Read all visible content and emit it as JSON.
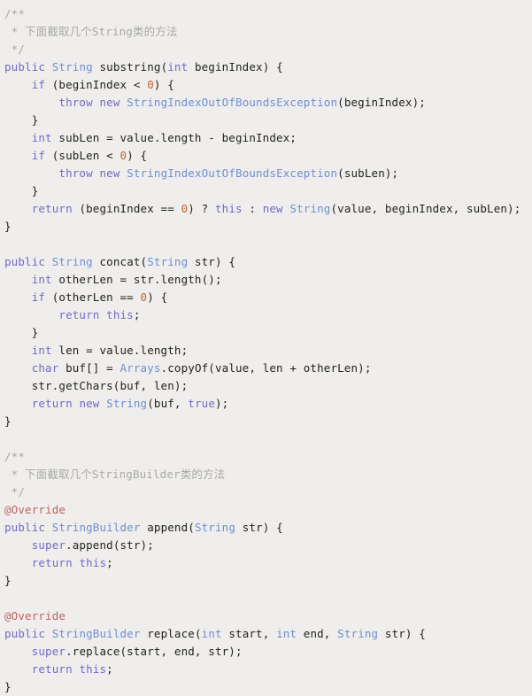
{
  "editor": {
    "language": "java",
    "background_color": "#efeeec",
    "default_text_color": "#22221f",
    "token_colors": {
      "keyword": "#7469c6",
      "type": "#6f8fd0",
      "number": "#c2642f",
      "comment": "#a9a9a4",
      "annotation": "#bd6360",
      "plain": "#22221f"
    }
  },
  "code": {
    "lines": [
      {
        "id": "l1",
        "text": "/**"
      },
      {
        "id": "l2",
        "text": " * 下面截取几个String类的方法"
      },
      {
        "id": "l3",
        "text": " */"
      },
      {
        "id": "l4",
        "text": "public String substring(int beginIndex) {"
      },
      {
        "id": "l5",
        "text": "    if (beginIndex < 0) {"
      },
      {
        "id": "l6",
        "text": "        throw new StringIndexOutOfBoundsException(beginIndex);"
      },
      {
        "id": "l7",
        "text": "    }"
      },
      {
        "id": "l8",
        "text": "    int subLen = value.length - beginIndex;"
      },
      {
        "id": "l9",
        "text": "    if (subLen < 0) {"
      },
      {
        "id": "l10",
        "text": "        throw new StringIndexOutOfBoundsException(subLen);"
      },
      {
        "id": "l11",
        "text": "    }"
      },
      {
        "id": "l12",
        "text": "    return (beginIndex == 0) ? this : new String(value, beginIndex, subLen);"
      },
      {
        "id": "l13",
        "text": "}"
      },
      {
        "id": "l14",
        "text": ""
      },
      {
        "id": "l15",
        "text": "public String concat(String str) {"
      },
      {
        "id": "l16",
        "text": "    int otherLen = str.length();"
      },
      {
        "id": "l17",
        "text": "    if (otherLen == 0) {"
      },
      {
        "id": "l18",
        "text": "        return this;"
      },
      {
        "id": "l19",
        "text": "    }"
      },
      {
        "id": "l20",
        "text": "    int len = value.length;"
      },
      {
        "id": "l21",
        "text": "    char buf[] = Arrays.copyOf(value, len + otherLen);"
      },
      {
        "id": "l22",
        "text": "    str.getChars(buf, len);"
      },
      {
        "id": "l23",
        "text": "    return new String(buf, true);"
      },
      {
        "id": "l24",
        "text": "}"
      },
      {
        "id": "l25",
        "text": ""
      },
      {
        "id": "l26",
        "text": "/**"
      },
      {
        "id": "l27",
        "text": " * 下面截取几个StringBuilder类的方法"
      },
      {
        "id": "l28",
        "text": " */"
      },
      {
        "id": "l29",
        "text": "@Override"
      },
      {
        "id": "l30",
        "text": "public StringBuilder append(String str) {"
      },
      {
        "id": "l31",
        "text": "    super.append(str);"
      },
      {
        "id": "l32",
        "text": "    return this;"
      },
      {
        "id": "l33",
        "text": "}"
      },
      {
        "id": "l34",
        "text": ""
      },
      {
        "id": "l35",
        "text": "@Override"
      },
      {
        "id": "l36",
        "text": "public StringBuilder replace(int start, int end, String str) {"
      },
      {
        "id": "l37",
        "text": "    super.replace(start, end, str);"
      },
      {
        "id": "l38",
        "text": "    return this;"
      },
      {
        "id": "l39",
        "text": "}"
      }
    ],
    "tokens": {
      "l1": [
        [
          "/**",
          "cmt"
        ]
      ],
      "l2": [
        [
          " * 下面截取几个String类的方法",
          "cmt"
        ]
      ],
      "l3": [
        [
          " */",
          "cmt"
        ]
      ],
      "l4": [
        [
          "public",
          "kw"
        ],
        [
          " ",
          "pln"
        ],
        [
          "String",
          "typ"
        ],
        [
          " substring(",
          "pln"
        ],
        [
          "int",
          "kw"
        ],
        [
          " beginIndex) {",
          "pln"
        ]
      ],
      "l5": [
        [
          "    ",
          "pln"
        ],
        [
          "if",
          "kw"
        ],
        [
          " (beginIndex < ",
          "pln"
        ],
        [
          "0",
          "num"
        ],
        [
          ") {",
          "pln"
        ]
      ],
      "l6": [
        [
          "        ",
          "pln"
        ],
        [
          "throw",
          "kw"
        ],
        [
          " ",
          "pln"
        ],
        [
          "new",
          "kw"
        ],
        [
          " ",
          "pln"
        ],
        [
          "StringIndexOutOfBoundsException",
          "typ"
        ],
        [
          "(beginIndex);",
          "pln"
        ]
      ],
      "l7": [
        [
          "    }",
          "pln"
        ]
      ],
      "l8": [
        [
          "    ",
          "pln"
        ],
        [
          "int",
          "kw"
        ],
        [
          " subLen = value.length - beginIndex;",
          "pln"
        ]
      ],
      "l9": [
        [
          "    ",
          "pln"
        ],
        [
          "if",
          "kw"
        ],
        [
          " (subLen < ",
          "pln"
        ],
        [
          "0",
          "num"
        ],
        [
          ") {",
          "pln"
        ]
      ],
      "l10": [
        [
          "        ",
          "pln"
        ],
        [
          "throw",
          "kw"
        ],
        [
          " ",
          "pln"
        ],
        [
          "new",
          "kw"
        ],
        [
          " ",
          "pln"
        ],
        [
          "StringIndexOutOfBoundsException",
          "typ"
        ],
        [
          "(subLen);",
          "pln"
        ]
      ],
      "l11": [
        [
          "    }",
          "pln"
        ]
      ],
      "l12": [
        [
          "    ",
          "pln"
        ],
        [
          "return",
          "kw"
        ],
        [
          " (beginIndex == ",
          "pln"
        ],
        [
          "0",
          "num"
        ],
        [
          ") ? ",
          "pln"
        ],
        [
          "this",
          "kw"
        ],
        [
          " : ",
          "pln"
        ],
        [
          "new",
          "kw"
        ],
        [
          " ",
          "pln"
        ],
        [
          "String",
          "typ"
        ],
        [
          "(value, beginIndex, subLen);",
          "pln"
        ]
      ],
      "l13": [
        [
          "}",
          "pln"
        ]
      ],
      "l14": [],
      "l15": [
        [
          "public",
          "kw"
        ],
        [
          " ",
          "pln"
        ],
        [
          "String",
          "typ"
        ],
        [
          " concat(",
          "pln"
        ],
        [
          "String",
          "typ"
        ],
        [
          " str) {",
          "pln"
        ]
      ],
      "l16": [
        [
          "    ",
          "pln"
        ],
        [
          "int",
          "kw"
        ],
        [
          " otherLen = str.length();",
          "pln"
        ]
      ],
      "l17": [
        [
          "    ",
          "pln"
        ],
        [
          "if",
          "kw"
        ],
        [
          " (otherLen == ",
          "pln"
        ],
        [
          "0",
          "num"
        ],
        [
          ") {",
          "pln"
        ]
      ],
      "l18": [
        [
          "        ",
          "pln"
        ],
        [
          "return",
          "kw"
        ],
        [
          " ",
          "pln"
        ],
        [
          "this",
          "kw"
        ],
        [
          ";",
          "pln"
        ]
      ],
      "l19": [
        [
          "    }",
          "pln"
        ]
      ],
      "l20": [
        [
          "    ",
          "pln"
        ],
        [
          "int",
          "kw"
        ],
        [
          " len = value.length;",
          "pln"
        ]
      ],
      "l21": [
        [
          "    ",
          "pln"
        ],
        [
          "char",
          "kw"
        ],
        [
          " buf[] = ",
          "pln"
        ],
        [
          "Arrays",
          "typ"
        ],
        [
          ".copyOf(value, len + otherLen);",
          "pln"
        ]
      ],
      "l22": [
        [
          "    str.getChars(buf, len);",
          "pln"
        ]
      ],
      "l23": [
        [
          "    ",
          "pln"
        ],
        [
          "return",
          "kw"
        ],
        [
          " ",
          "pln"
        ],
        [
          "new",
          "kw"
        ],
        [
          " ",
          "pln"
        ],
        [
          "String",
          "typ"
        ],
        [
          "(buf, ",
          "pln"
        ],
        [
          "true",
          "kw"
        ],
        [
          ");",
          "pln"
        ]
      ],
      "l24": [
        [
          "}",
          "pln"
        ]
      ],
      "l25": [],
      "l26": [
        [
          "/**",
          "cmt"
        ]
      ],
      "l27": [
        [
          " * 下面截取几个StringBuilder类的方法",
          "cmt"
        ]
      ],
      "l28": [
        [
          " */",
          "cmt"
        ]
      ],
      "l29": [
        [
          "@Override",
          "ann"
        ]
      ],
      "l30": [
        [
          "public",
          "kw"
        ],
        [
          " ",
          "pln"
        ],
        [
          "StringBuilder",
          "typ"
        ],
        [
          " append(",
          "pln"
        ],
        [
          "String",
          "typ"
        ],
        [
          " str) {",
          "pln"
        ]
      ],
      "l31": [
        [
          "    ",
          "pln"
        ],
        [
          "super",
          "kw"
        ],
        [
          ".append(str);",
          "pln"
        ]
      ],
      "l32": [
        [
          "    ",
          "pln"
        ],
        [
          "return",
          "kw"
        ],
        [
          " ",
          "pln"
        ],
        [
          "this",
          "kw"
        ],
        [
          ";",
          "pln"
        ]
      ],
      "l33": [
        [
          "}",
          "pln"
        ]
      ],
      "l34": [],
      "l35": [
        [
          "@Override",
          "ann"
        ]
      ],
      "l36": [
        [
          "public",
          "kw"
        ],
        [
          " ",
          "pln"
        ],
        [
          "StringBuilder",
          "typ"
        ],
        [
          " replace(",
          "pln"
        ],
        [
          "int",
          "typ"
        ],
        [
          " start, ",
          "pln"
        ],
        [
          "int",
          "typ"
        ],
        [
          " end, ",
          "pln"
        ],
        [
          "String",
          "typ"
        ],
        [
          " str) {",
          "pln"
        ]
      ],
      "l37": [
        [
          "    ",
          "pln"
        ],
        [
          "super",
          "kw"
        ],
        [
          ".replace(start, end, str);",
          "pln"
        ]
      ],
      "l38": [
        [
          "    ",
          "pln"
        ],
        [
          "return",
          "kw"
        ],
        [
          " ",
          "pln"
        ],
        [
          "this",
          "kw"
        ],
        [
          ";",
          "pln"
        ]
      ],
      "l39": [
        [
          "}",
          "pln"
        ]
      ]
    }
  }
}
